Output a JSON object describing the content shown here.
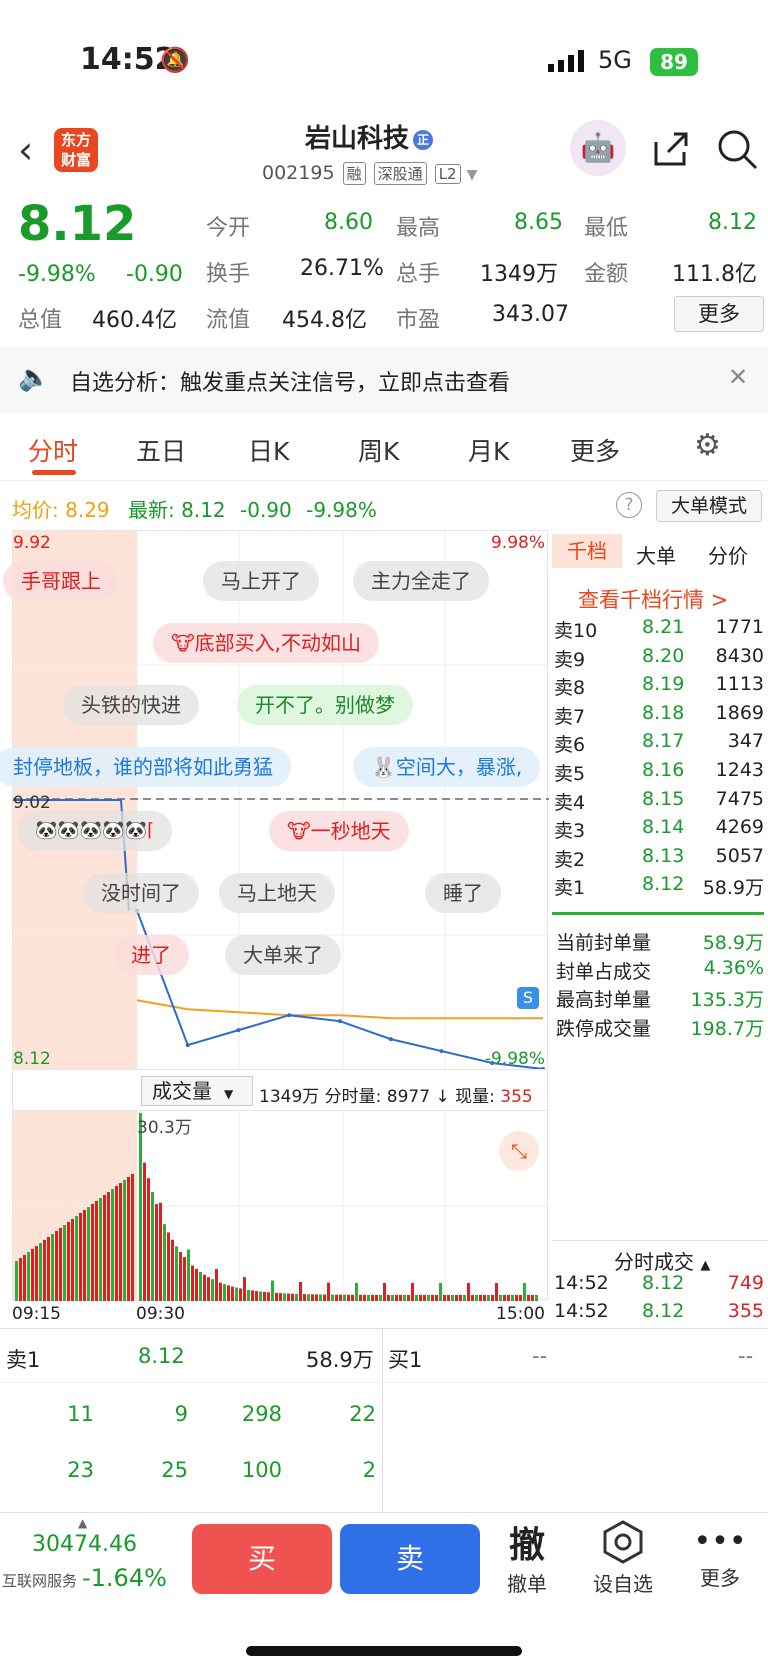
{
  "status": {
    "time": "14:52",
    "network": "5G",
    "battery": "89"
  },
  "header": {
    "logo": "东方财富",
    "title": "岩山科技",
    "code": "002195",
    "tags": [
      "融",
      "深股通",
      "L2"
    ]
  },
  "quote": {
    "price": "8.12",
    "change_pct": "-9.98%",
    "change": "-0.90",
    "open_label": "今开",
    "open": "8.60",
    "high_label": "最高",
    "high": "8.65",
    "low_label": "最低",
    "low": "8.12",
    "turnover_label": "换手",
    "turnover": "26.71%",
    "volume_label": "总手",
    "volume": "1349万",
    "amount_label": "金额",
    "amount": "111.8亿",
    "mktcap_label": "总值",
    "mktcap": "460.4亿",
    "float_label": "流值",
    "float": "454.8亿",
    "pe_label": "市盈",
    "pe": "343.07",
    "more": "更多"
  },
  "notice": {
    "text": "自选分析：触发重点关注信号，立即点击查看"
  },
  "tabs": [
    "分时",
    "五日",
    "日K",
    "周K",
    "月K",
    "更多"
  ],
  "chart_info": {
    "avg_label": "均价:",
    "avg": "8.29",
    "latest_label": "最新:",
    "latest": "8.12",
    "chg": "-0.90",
    "pct": "-9.98%",
    "mode": "大单模式",
    "top_price": "9.92",
    "top_pct": "9.98%",
    "mid_price": "9.02",
    "bottom_price": "8.12",
    "bottom_pct": "-9.98%",
    "vol_select": "成交量",
    "vol_info": "1349万 分时量: 8977 ↓ 现量:",
    "vol_now": "355",
    "vol_max": "30.3万",
    "t_start": "09:15",
    "t_open": "09:30",
    "t_end": "15:00"
  },
  "bubbles": [
    "手哥跟上",
    "马上开了",
    "主力全走了",
    "底部买入,不动如山",
    "头铁的快进",
    "开不了。别做梦",
    "封停地板，谁的部将如此勇猛",
    "空间大，暴涨,",
    "一秒地天",
    "没时间了",
    "马上地天",
    "睡了",
    "进了",
    "大单来了"
  ],
  "orderbook": {
    "tabs": [
      "千档",
      "大单",
      "分价"
    ],
    "link": "查看千档行情 >",
    "asks": [
      [
        "卖10",
        "8.21",
        "1771"
      ],
      [
        "卖9",
        "8.20",
        "8430"
      ],
      [
        "卖8",
        "8.19",
        "1113"
      ],
      [
        "卖7",
        "8.18",
        "1869"
      ],
      [
        "卖6",
        "8.17",
        "347"
      ],
      [
        "卖5",
        "8.16",
        "1243"
      ],
      [
        "卖4",
        "8.15",
        "7475"
      ],
      [
        "卖3",
        "8.14",
        "4269"
      ],
      [
        "卖2",
        "8.13",
        "5057"
      ],
      [
        "卖1",
        "8.12",
        "58.9万"
      ]
    ],
    "stats": [
      [
        "当前封单量",
        "58.9万"
      ],
      [
        "封单占成交",
        "4.36%"
      ],
      [
        "最高封单量",
        "135.3万"
      ],
      [
        "跌停成交量",
        "198.7万"
      ]
    ],
    "trades_title": "分时成交",
    "trades": [
      [
        "14:52",
        "8.12",
        "749"
      ],
      [
        "14:52",
        "8.12",
        "355"
      ]
    ]
  },
  "bottom_book": {
    "sell_label": "卖1",
    "sell_price": "8.12",
    "sell_vol": "58.9万",
    "buy_label": "买1",
    "buy_price": "--",
    "buy_vol": "--",
    "row1": [
      "11",
      "9",
      "298",
      "22"
    ],
    "row2": [
      "23",
      "25",
      "100",
      "2"
    ]
  },
  "footer": {
    "index": "30474.46",
    "index_name": "互联网服务",
    "index_pct": "-1.64%",
    "buy": "买",
    "sell": "卖",
    "cancel": "撤单",
    "cancel_icon": "撤",
    "watch": "设自选",
    "more": "更多"
  },
  "chart_data": {
    "type": "line",
    "x": [
      "09:30",
      "10:00",
      "10:30",
      "11:00",
      "11:30",
      "13:30",
      "14:00",
      "14:30",
      "15:00"
    ],
    "price": [
      8.65,
      8.2,
      8.25,
      8.3,
      8.28,
      8.22,
      8.18,
      8.14,
      8.12
    ],
    "avg": [
      8.35,
      8.32,
      8.31,
      8.3,
      8.3,
      8.29,
      8.29,
      8.29,
      8.29
    ],
    "ylim": [
      8.12,
      9.92
    ]
  }
}
